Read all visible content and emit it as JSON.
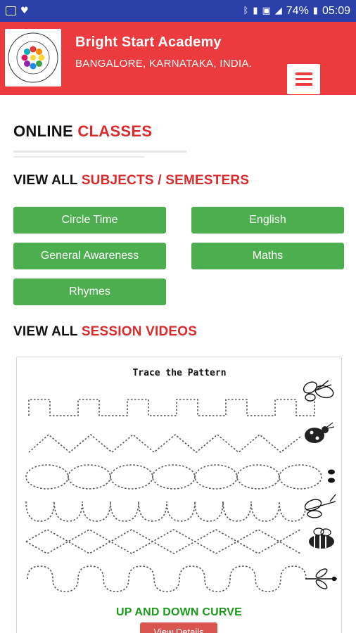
{
  "status_bar": {
    "battery": "74%",
    "time": "05:09"
  },
  "header": {
    "brand_name": "Bright Start Academy",
    "location": "BANGALORE, KARNATAKA, INDIA.",
    "logo_text_top": "Bright Start Academy",
    "logo_text_bottom": "Bright Start Academy"
  },
  "page": {
    "title_part1": "ONLINE",
    "title_part2": "CLASSES",
    "subjects_heading_part1": "VIEW ALL",
    "subjects_heading_part2": "SUBJECTS / SEMESTERS",
    "videos_heading_part1": "VIEW ALL",
    "videos_heading_part2": "SESSION VIDEOS"
  },
  "subjects": [
    {
      "label": "Circle Time"
    },
    {
      "label": "English"
    },
    {
      "label": "General Awareness"
    },
    {
      "label": "Maths"
    },
    {
      "label": "Rhymes"
    }
  ],
  "video_card": {
    "worksheet_title": "Trace the Pattern",
    "caption": "UP AND DOWN CURVE",
    "button_label": "View Details"
  },
  "colors": {
    "header_red": "#ec3b3f",
    "accent_red": "#d92b2b",
    "button_green": "#4cae4f",
    "caption_green": "#1a9a1a",
    "status_blue": "#2b3fa8"
  }
}
